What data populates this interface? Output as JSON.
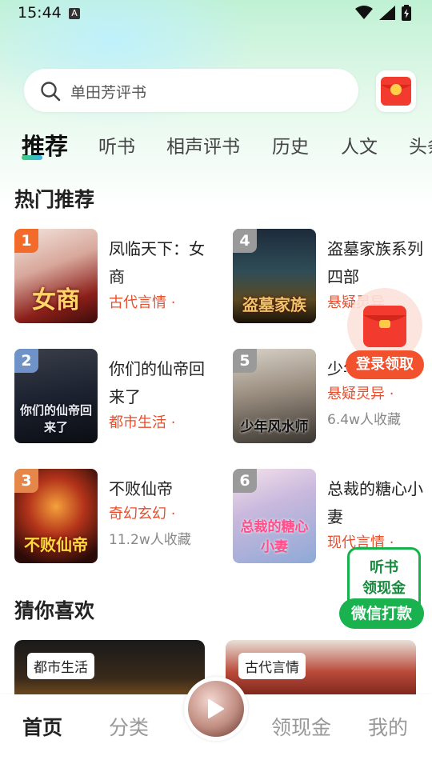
{
  "status": {
    "time": "15:44",
    "indicator": "A"
  },
  "search": {
    "placeholder_text": "单田芳评书"
  },
  "tabs": [
    {
      "label": "推荐"
    },
    {
      "label": "听书"
    },
    {
      "label": "相声评书"
    },
    {
      "label": "历史"
    },
    {
      "label": "人文"
    },
    {
      "label": "头条"
    }
  ],
  "hot": {
    "title": "热门推荐",
    "books": [
      {
        "rank": "1",
        "title": "凤临天下：女商",
        "genre": "古代言情 ·",
        "count": "",
        "cover_text": "女商",
        "rank_color": "#f26b2a"
      },
      {
        "rank": "2",
        "title": "你们的仙帝回来了",
        "genre": "都市生活 ·",
        "count": "",
        "cover_text": "你们的仙帝回来了",
        "rank_color": "#6f93c8"
      },
      {
        "rank": "3",
        "title": "不败仙帝",
        "genre": "奇幻玄幻 ·",
        "count": "11.2w人收藏",
        "cover_text": "不败仙帝",
        "rank_color": "#e5874b"
      },
      {
        "rank": "4",
        "title": "盗墓家族系列四部",
        "genre": "悬疑灵异",
        "count": "",
        "cover_text": "盗墓家族",
        "rank_color": "#9a9a9a"
      },
      {
        "rank": "5",
        "title": "少年风水师",
        "genre": "悬疑灵异 ·",
        "count": "6.4w人收藏",
        "cover_text": "少年风水师",
        "rank_color": "#9a9a9a"
      },
      {
        "rank": "6",
        "title": "总裁的糖心小妻",
        "genre": "现代言情 ·",
        "count": "",
        "cover_text": "总裁的糖心小妻",
        "rank_color": "#9a9a9a"
      }
    ]
  },
  "login_float": {
    "label": "登录领取"
  },
  "cash_float": {
    "line1": "听书",
    "line2": "领现金",
    "button": "微信打款"
  },
  "guess": {
    "title": "猜你喜欢",
    "cards": [
      {
        "tag": "都市生活"
      },
      {
        "tag": "古代言情"
      }
    ]
  },
  "nav": {
    "home": "首页",
    "category": "分类",
    "earn": "领现金",
    "mine": "我的"
  },
  "colors": {
    "accent": "#19b24e",
    "genre": "#e84d2c",
    "login": "#f2512e"
  }
}
